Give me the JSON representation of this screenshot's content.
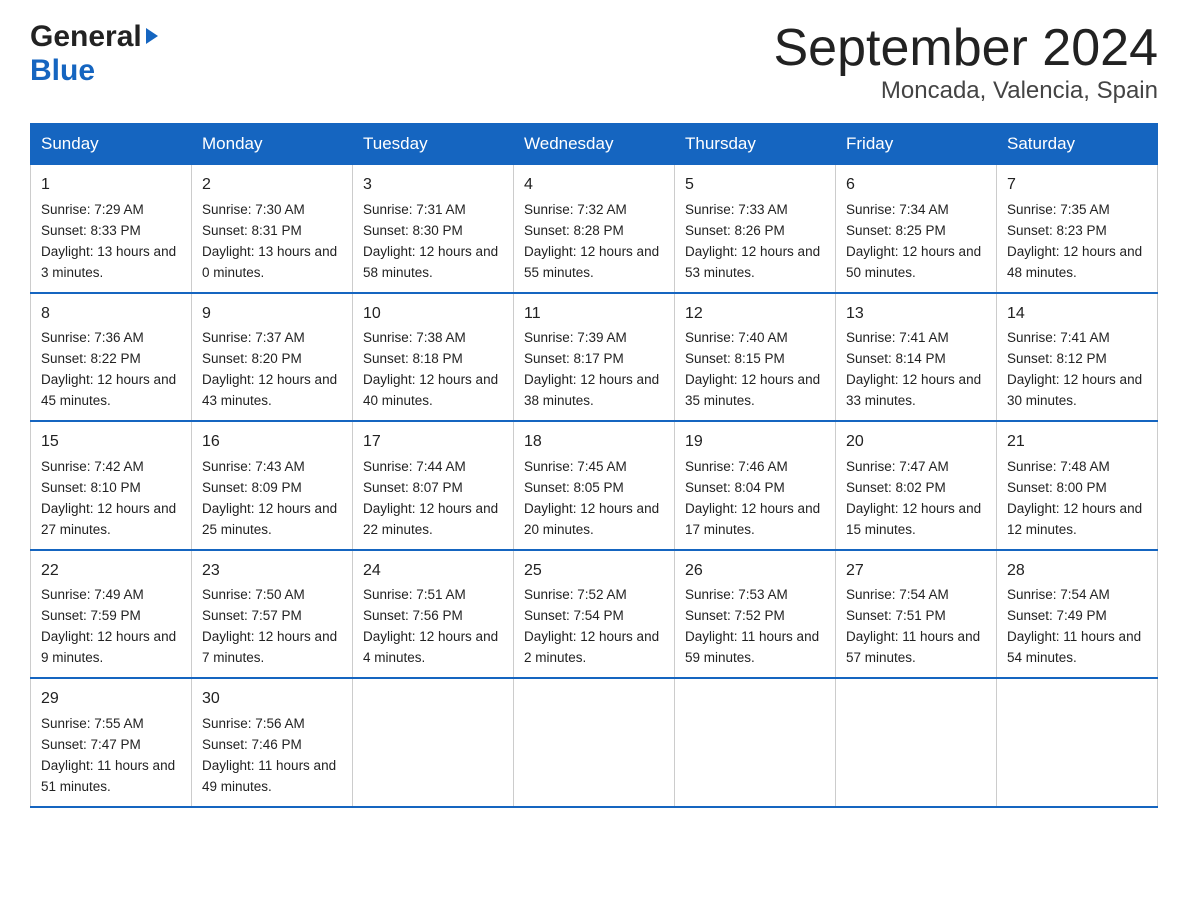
{
  "logo": {
    "general": "General",
    "blue": "Blue"
  },
  "title": "September 2024",
  "subtitle": "Moncada, Valencia, Spain",
  "days": [
    "Sunday",
    "Monday",
    "Tuesday",
    "Wednesday",
    "Thursday",
    "Friday",
    "Saturday"
  ],
  "weeks": [
    [
      {
        "num": "1",
        "sunrise": "7:29 AM",
        "sunset": "8:33 PM",
        "daylight": "13 hours and 3 minutes."
      },
      {
        "num": "2",
        "sunrise": "7:30 AM",
        "sunset": "8:31 PM",
        "daylight": "13 hours and 0 minutes."
      },
      {
        "num": "3",
        "sunrise": "7:31 AM",
        "sunset": "8:30 PM",
        "daylight": "12 hours and 58 minutes."
      },
      {
        "num": "4",
        "sunrise": "7:32 AM",
        "sunset": "8:28 PM",
        "daylight": "12 hours and 55 minutes."
      },
      {
        "num": "5",
        "sunrise": "7:33 AM",
        "sunset": "8:26 PM",
        "daylight": "12 hours and 53 minutes."
      },
      {
        "num": "6",
        "sunrise": "7:34 AM",
        "sunset": "8:25 PM",
        "daylight": "12 hours and 50 minutes."
      },
      {
        "num": "7",
        "sunrise": "7:35 AM",
        "sunset": "8:23 PM",
        "daylight": "12 hours and 48 minutes."
      }
    ],
    [
      {
        "num": "8",
        "sunrise": "7:36 AM",
        "sunset": "8:22 PM",
        "daylight": "12 hours and 45 minutes."
      },
      {
        "num": "9",
        "sunrise": "7:37 AM",
        "sunset": "8:20 PM",
        "daylight": "12 hours and 43 minutes."
      },
      {
        "num": "10",
        "sunrise": "7:38 AM",
        "sunset": "8:18 PM",
        "daylight": "12 hours and 40 minutes."
      },
      {
        "num": "11",
        "sunrise": "7:39 AM",
        "sunset": "8:17 PM",
        "daylight": "12 hours and 38 minutes."
      },
      {
        "num": "12",
        "sunrise": "7:40 AM",
        "sunset": "8:15 PM",
        "daylight": "12 hours and 35 minutes."
      },
      {
        "num": "13",
        "sunrise": "7:41 AM",
        "sunset": "8:14 PM",
        "daylight": "12 hours and 33 minutes."
      },
      {
        "num": "14",
        "sunrise": "7:41 AM",
        "sunset": "8:12 PM",
        "daylight": "12 hours and 30 minutes."
      }
    ],
    [
      {
        "num": "15",
        "sunrise": "7:42 AM",
        "sunset": "8:10 PM",
        "daylight": "12 hours and 27 minutes."
      },
      {
        "num": "16",
        "sunrise": "7:43 AM",
        "sunset": "8:09 PM",
        "daylight": "12 hours and 25 minutes."
      },
      {
        "num": "17",
        "sunrise": "7:44 AM",
        "sunset": "8:07 PM",
        "daylight": "12 hours and 22 minutes."
      },
      {
        "num": "18",
        "sunrise": "7:45 AM",
        "sunset": "8:05 PM",
        "daylight": "12 hours and 20 minutes."
      },
      {
        "num": "19",
        "sunrise": "7:46 AM",
        "sunset": "8:04 PM",
        "daylight": "12 hours and 17 minutes."
      },
      {
        "num": "20",
        "sunrise": "7:47 AM",
        "sunset": "8:02 PM",
        "daylight": "12 hours and 15 minutes."
      },
      {
        "num": "21",
        "sunrise": "7:48 AM",
        "sunset": "8:00 PM",
        "daylight": "12 hours and 12 minutes."
      }
    ],
    [
      {
        "num": "22",
        "sunrise": "7:49 AM",
        "sunset": "7:59 PM",
        "daylight": "12 hours and 9 minutes."
      },
      {
        "num": "23",
        "sunrise": "7:50 AM",
        "sunset": "7:57 PM",
        "daylight": "12 hours and 7 minutes."
      },
      {
        "num": "24",
        "sunrise": "7:51 AM",
        "sunset": "7:56 PM",
        "daylight": "12 hours and 4 minutes."
      },
      {
        "num": "25",
        "sunrise": "7:52 AM",
        "sunset": "7:54 PM",
        "daylight": "12 hours and 2 minutes."
      },
      {
        "num": "26",
        "sunrise": "7:53 AM",
        "sunset": "7:52 PM",
        "daylight": "11 hours and 59 minutes."
      },
      {
        "num": "27",
        "sunrise": "7:54 AM",
        "sunset": "7:51 PM",
        "daylight": "11 hours and 57 minutes."
      },
      {
        "num": "28",
        "sunrise": "7:54 AM",
        "sunset": "7:49 PM",
        "daylight": "11 hours and 54 minutes."
      }
    ],
    [
      {
        "num": "29",
        "sunrise": "7:55 AM",
        "sunset": "7:47 PM",
        "daylight": "11 hours and 51 minutes."
      },
      {
        "num": "30",
        "sunrise": "7:56 AM",
        "sunset": "7:46 PM",
        "daylight": "11 hours and 49 minutes."
      },
      null,
      null,
      null,
      null,
      null
    ]
  ],
  "labels": {
    "sunrise": "Sunrise: ",
    "sunset": "Sunset: ",
    "daylight": "Daylight: "
  }
}
